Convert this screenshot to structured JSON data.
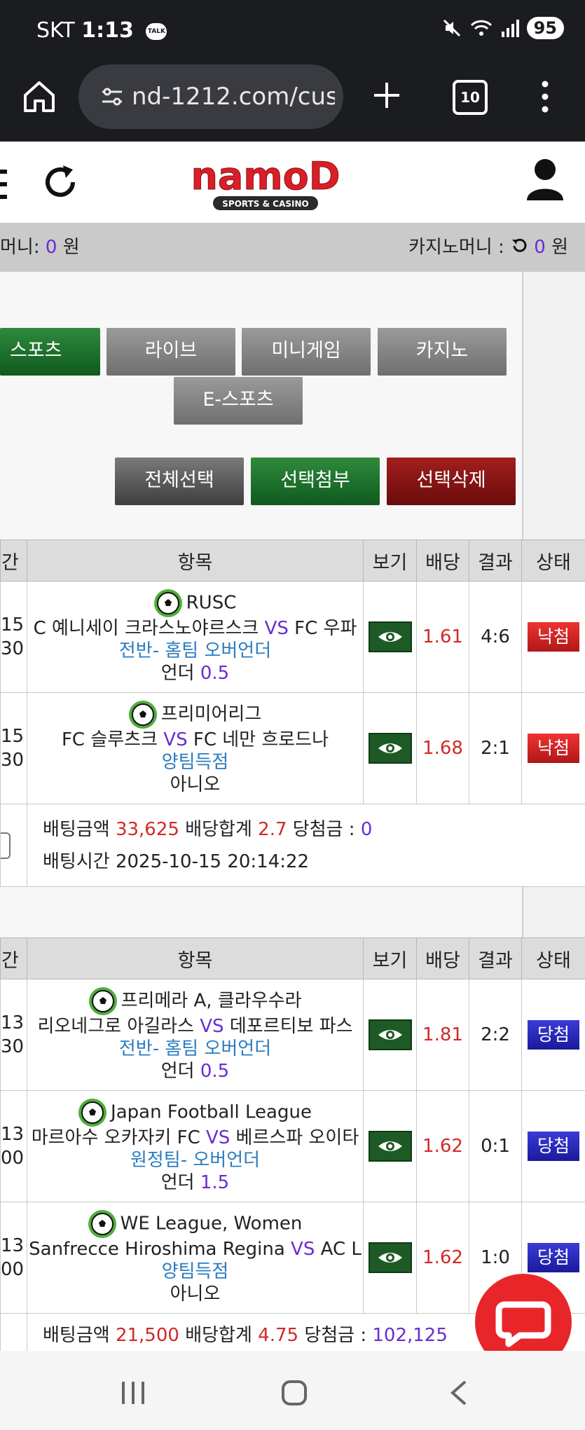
{
  "status_bar": {
    "carrier": "SKT",
    "time": "1:13",
    "talk": "TALK",
    "battery": "95"
  },
  "browser": {
    "url": "nd-1212.com/cust",
    "tab_count": "10"
  },
  "site": {
    "logo_text": "namoD",
    "logo_sub": "SPORTS & CASINO"
  },
  "money": {
    "left_label": "머니:",
    "left_value": "0",
    "left_unit": "원",
    "right_label": "카지노머니 :",
    "right_value": "0",
    "right_unit": "원"
  },
  "categories": [
    "스포츠",
    "라이브",
    "미니게임",
    "카지노",
    "E-스포츠"
  ],
  "actions": {
    "select_all": "전체선택",
    "attach": "선택첨부",
    "delete": "선택삭제"
  },
  "table_headers": {
    "time": "간",
    "item": "항목",
    "view": "보기",
    "odds": "배당",
    "result": "결과",
    "status": "상태"
  },
  "bet1": {
    "rows": [
      {
        "time1": "15",
        "time2": "30",
        "league": "RUSC",
        "home": "C 예니세이 크라스노야르스크",
        "vs": "VS",
        "away": "FC 우파",
        "market": "전반- 홈팀 오버언더",
        "pick_label": "언더",
        "pick_value": "0.5",
        "odds": "1.61",
        "result": "4:6",
        "status": "낙첨"
      },
      {
        "time1": "15",
        "time2": "30",
        "league": "프리미어리그",
        "home": "FC 슬루츠크",
        "vs": "VS",
        "away": "FC 네만 흐로드나",
        "market": "양팀득점",
        "pick_label": "아니오",
        "pick_value": "",
        "odds": "1.68",
        "result": "2:1",
        "status": "낙첨"
      }
    ],
    "summary": {
      "amount_label": "배팅금액",
      "amount": "33,625",
      "total_label": "배당합계",
      "total": "2.7",
      "win_label": "당첨금 :",
      "win": "0",
      "time_label": "배팅시간",
      "time": "2025-10-15 20:14:22"
    }
  },
  "bet2": {
    "rows": [
      {
        "time1": "13",
        "time2": "30",
        "league": "프리메라 A, 클라우수라",
        "home": "리오네그로 아길라스",
        "vs": "VS",
        "away": "데포르티보 파스",
        "market": "전반- 홈팀 오버언더",
        "pick_label": "언더",
        "pick_value": "0.5",
        "odds": "1.81",
        "result": "2:2",
        "status": "당첨"
      },
      {
        "time1": "13",
        "time2": "00",
        "league": "Japan Football League",
        "home": "마르아수 오카자키 FC",
        "vs": "VS",
        "away": "베르스파 오이타",
        "market": "원정팀- 오버언더",
        "pick_label": "언더",
        "pick_value": "1.5",
        "odds": "1.62",
        "result": "0:1",
        "status": "당첨"
      },
      {
        "time1": "13",
        "time2": "00",
        "league": "WE League, Women",
        "home": "Sanfrecce Hiroshima Regina",
        "vs": "VS",
        "away": "AC L",
        "market": "양팀득점",
        "pick_label": "아니오",
        "pick_value": "",
        "odds": "1.62",
        "result": "1:0",
        "status": "당첨"
      }
    ],
    "summary": {
      "amount_label": "배팅금액",
      "amount": "21,500",
      "total_label": "배당합계",
      "total": "4.75",
      "win_label": "당첨금 :",
      "win": "102,125"
    }
  }
}
